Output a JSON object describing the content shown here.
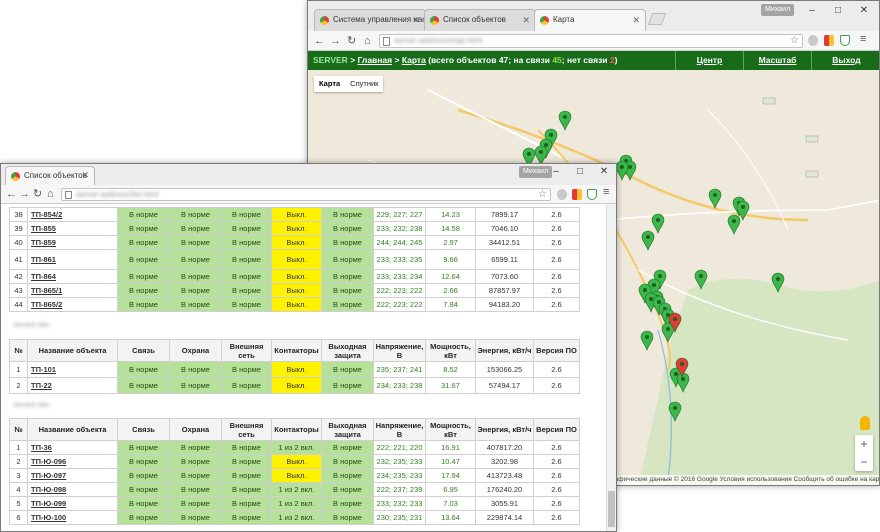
{
  "map_window": {
    "tabs": [
      {
        "label": "Система управления нас"
      },
      {
        "label": "Список объектов"
      },
      {
        "label": "Карта"
      }
    ],
    "user_badge": "Михаил",
    "controls": {
      "minimize": "–",
      "maximize": "□",
      "close": "✕"
    },
    "header": {
      "server": "SERVER",
      "sep": ">",
      "home": "Главная",
      "map_link": "Карта",
      "summary_prefix": "(всего объектов 47; на связи",
      "online": "45",
      "summary_mid": "; нет связи",
      "offline": "2",
      "summary_suffix": ")",
      "nav": [
        "Центр",
        "Масштаб",
        "Выход"
      ]
    },
    "map_types": [
      "Карта",
      "Спутник"
    ],
    "zoom": {
      "in": "+",
      "out": "−"
    },
    "copyright": "рафические данные © 2016 Google   Условия использования   Сообщить об ошибке на карте"
  },
  "list_window": {
    "tab": "Список объектов",
    "user_badge": "Михаил",
    "table1_rows": [
      {
        "n": "38",
        "name": "ТП-854/2",
        "svyaz": "В норме",
        "ohrana": "В норме",
        "set": "В норме",
        "kont": "Выкл.",
        "zash": "В норме",
        "volt": "229; 227; 227",
        "power": "14.23",
        "energy": "7899.17",
        "ver": "2.6"
      },
      {
        "n": "39",
        "name": "ТП-855",
        "svyaz": "В норме",
        "ohrana": "В норме",
        "set": "В норме",
        "kont": "Выкл.",
        "zash": "В норме",
        "volt": "233; 232; 238",
        "power": "14.58",
        "energy": "7046.10",
        "ver": "2.6"
      },
      {
        "n": "40",
        "name": "ТП-859",
        "svyaz": "В норме",
        "ohrana": "В норме",
        "set": "В норме",
        "kont": "Выкл.",
        "zash": "В норме",
        "volt": "244; 244; 245",
        "power": "2.97",
        "energy": "34412.51",
        "ver": "2.6"
      },
      {
        "n": "41",
        "name": "ТП-861",
        "svyaz": "В норме",
        "ohrana": "В норме",
        "set": "В норме",
        "kont": "Выкл.",
        "zash": "В норме",
        "volt": "233; 233; 235",
        "power": "9.66",
        "energy": "6599.11",
        "ver": "2.6"
      },
      {
        "n": "42",
        "name": "ТП-864",
        "svyaz": "В норме",
        "ohrana": "В норме",
        "set": "В норме",
        "kont": "Выкл.",
        "zash": "В норме",
        "volt": "233; 233; 234",
        "power": "12.64",
        "energy": "7073.60",
        "ver": "2.6"
      },
      {
        "n": "43",
        "name": "ТП-865/1",
        "svyaz": "В норме",
        "ohrana": "В норме",
        "set": "В норме",
        "kont": "Выкл.",
        "zash": "В норме",
        "volt": "222; 223; 222",
        "power": "2.66",
        "energy": "87857.97",
        "ver": "2.6"
      },
      {
        "n": "44",
        "name": "ТП-865/2",
        "svyaz": "В норме",
        "ohrana": "В норме",
        "set": "В норме",
        "kont": "Выкл.",
        "zash": "В норме",
        "volt": "222; 223; 222",
        "power": "7.84",
        "energy": "94183.20",
        "ver": "2.6"
      }
    ],
    "headers": [
      "№",
      "Название объекта",
      "Связь",
      "Охрана",
      "Внешняя сеть",
      "Контакторы",
      "Выходная защита",
      "Напряжение, В",
      "Мощность, кВт",
      "Энергия, кВт/ч",
      "Версия ПО"
    ],
    "table2_rows": [
      {
        "n": "1",
        "name": "ТП-101",
        "svyaz": "В норме",
        "ohrana": "В норме",
        "set": "В норме",
        "kont": "Выкл.",
        "zash": "В норме",
        "volt": "235; 237; 241",
        "power": "8.52",
        "energy": "153066.25",
        "ver": "2.6"
      },
      {
        "n": "2",
        "name": "ТП-22",
        "svyaz": "В норме",
        "ohrana": "В норме",
        "set": "В норме",
        "kont": "Выкл.",
        "zash": "В норме",
        "volt": "234; 233; 238",
        "power": "31.67",
        "energy": "57494.17",
        "ver": "2.6"
      }
    ],
    "table3_rows": [
      {
        "n": "1",
        "name": "ТП-36",
        "svyaz": "В норме",
        "ohrana": "В норме",
        "set": "В норме",
        "kont": "1 из 2 вкл.",
        "zash": "В норме",
        "volt": "222; 221; 220",
        "power": "16.91",
        "energy": "407817.20",
        "ver": "2.6"
      },
      {
        "n": "2",
        "name": "ТП-Ю-096",
        "svyaz": "В норме",
        "ohrana": "В норме",
        "set": "В норме",
        "kont": "Выкл.",
        "zash": "В норме",
        "volt": "232; 235; 233",
        "power": "10.47",
        "energy": "3202.98",
        "ver": "2.6"
      },
      {
        "n": "3",
        "name": "ТП-Ю-097",
        "svyaz": "В норме",
        "ohrana": "В норме",
        "set": "В норме",
        "kont": "Выкл.",
        "zash": "В норме",
        "volt": "234; 235; 233",
        "power": "17.94",
        "energy": "413723.48",
        "ver": "2.6"
      },
      {
        "n": "4",
        "name": "ТП-Ю-098",
        "svyaz": "В норме",
        "ohrana": "В норме",
        "set": "В норме",
        "kont": "1 из 2 вкл.",
        "zash": "В норме",
        "volt": "222; 237; 239",
        "power": "6.95",
        "energy": "176240.20",
        "ver": "2.6"
      },
      {
        "n": "5",
        "name": "ТП-Ю-099",
        "svyaz": "В норме",
        "ohrana": "В норме",
        "set": "В норме",
        "kont": "1 из 2 вкл.",
        "zash": "В норме",
        "volt": "233; 232; 233",
        "power": "7.03",
        "energy": "3055.91",
        "ver": "2.6"
      },
      {
        "n": "6",
        "name": "ТП-Ю-100",
        "svyaz": "В норме",
        "ohrana": "В норме",
        "set": "В норме",
        "kont": "1 из 2 вкл.",
        "zash": "В норме",
        "volt": "230; 235; 231",
        "power": "13.64",
        "energy": "229874.14",
        "ver": "2.6"
      }
    ]
  },
  "colors": {
    "header_green": "#176b19",
    "status_ok": "#b5e19a",
    "contactor_off": "#fff200",
    "marker_online": "#3cb84a",
    "marker_offline": "#e53935"
  }
}
